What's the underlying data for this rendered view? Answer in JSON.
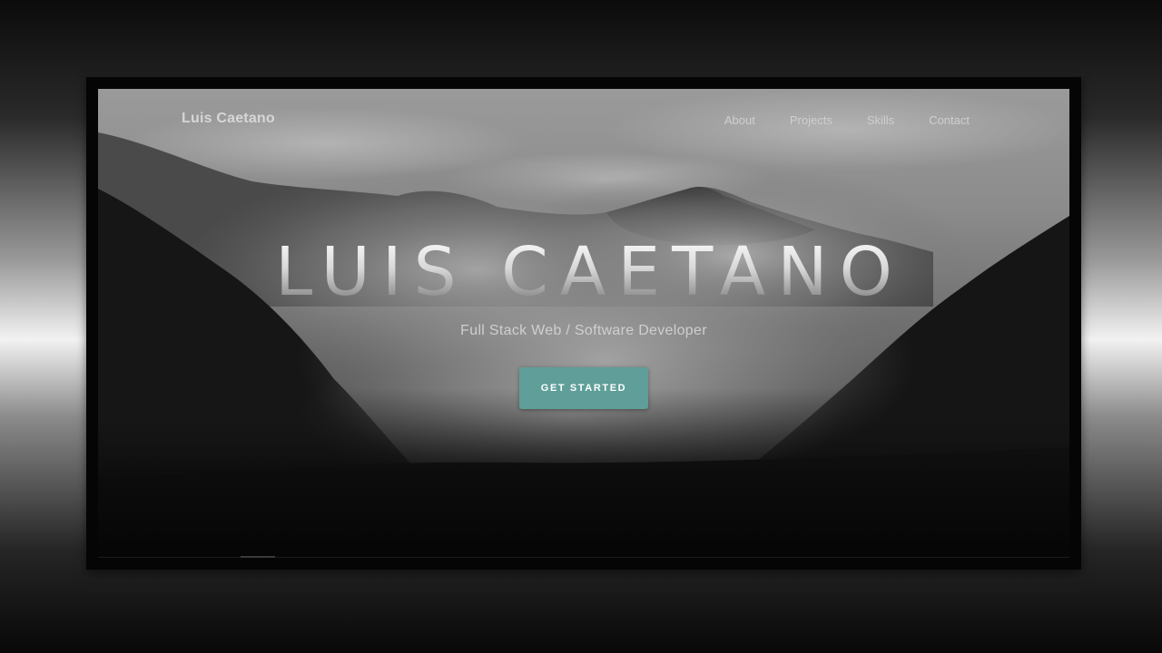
{
  "navbar": {
    "brand": "Luis Caetano",
    "links": [
      {
        "label": "About"
      },
      {
        "label": "Projects"
      },
      {
        "label": "Skills"
      },
      {
        "label": "Contact"
      }
    ]
  },
  "hero": {
    "title": "LUIS CAETANO",
    "subtitle": "Full Stack Web / Software Developer",
    "cta_label": "GET STARTED"
  },
  "colors": {
    "accent": "#5f9e99",
    "frame": "#050505"
  }
}
